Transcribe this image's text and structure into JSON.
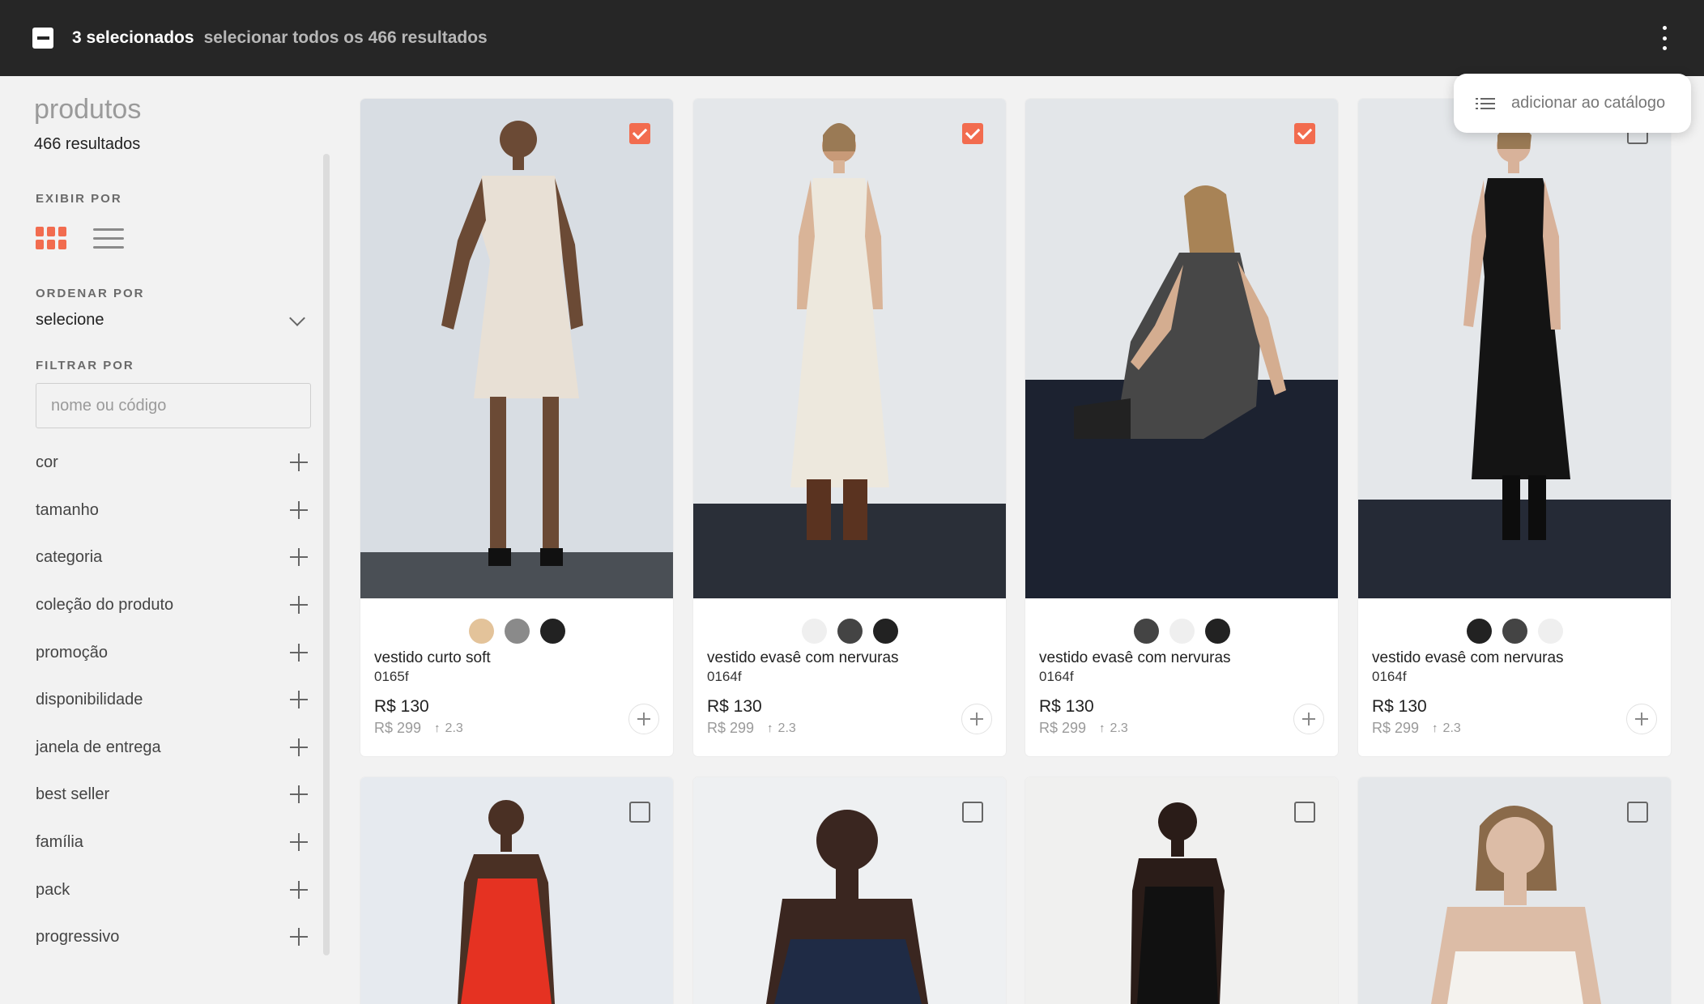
{
  "selection_bar": {
    "count_label": "3 selecionados",
    "select_all_label": "selecionar todos os 466 resultados"
  },
  "menu": {
    "items": [
      {
        "label": "adicionar ao catálogo",
        "icon": "list-icon"
      }
    ]
  },
  "sidebar": {
    "title": "produtos",
    "result_count": "466 resultados",
    "view_label": "EXIBIR POR",
    "view_modes": [
      {
        "icon": "grid-view-icon",
        "active": true
      },
      {
        "icon": "list-view-icon",
        "active": false
      }
    ],
    "sort_label": "ORDENAR POR",
    "sort_value": "selecione",
    "filter_label": "FILTRAR POR",
    "search_placeholder": "nome ou código",
    "filters": [
      "cor",
      "tamanho",
      "categoria",
      "coleção do produto",
      "promoção",
      "disponibilidade",
      "janela de entrega",
      "best seller",
      "família",
      "pack",
      "progressivo"
    ]
  },
  "colors": {
    "accent": "#f26c4f",
    "topbar": "#262626"
  },
  "products": [
    {
      "name": "vestido curto soft",
      "code": "0165f",
      "price": "R$ 130",
      "old_price": "R$ 299",
      "trend": "2.3",
      "selected": true,
      "swatches": [
        "#e3c39a",
        "#8a8a8a",
        "#222222"
      ]
    },
    {
      "name": "vestido evasê com nervuras",
      "code": "0164f",
      "price": "R$ 130",
      "old_price": "R$ 299",
      "trend": "2.3",
      "selected": true,
      "swatches": [
        "#efefef",
        "#444444",
        "#222222"
      ]
    },
    {
      "name": "vestido evasê com nervuras",
      "code": "0164f",
      "price": "R$ 130",
      "old_price": "R$ 299",
      "trend": "2.3",
      "selected": true,
      "swatches": [
        "#444444",
        "#efefef",
        "#222222"
      ]
    },
    {
      "name": "vestido evasê com nervuras",
      "code": "0164f",
      "price": "R$ 130",
      "old_price": "R$ 299",
      "trend": "2.3",
      "selected": false,
      "swatches": [
        "#222222",
        "#444444",
        "#efefef"
      ]
    },
    {
      "selected": false
    },
    {
      "selected": false
    },
    {
      "selected": false
    },
    {
      "selected": false
    }
  ]
}
